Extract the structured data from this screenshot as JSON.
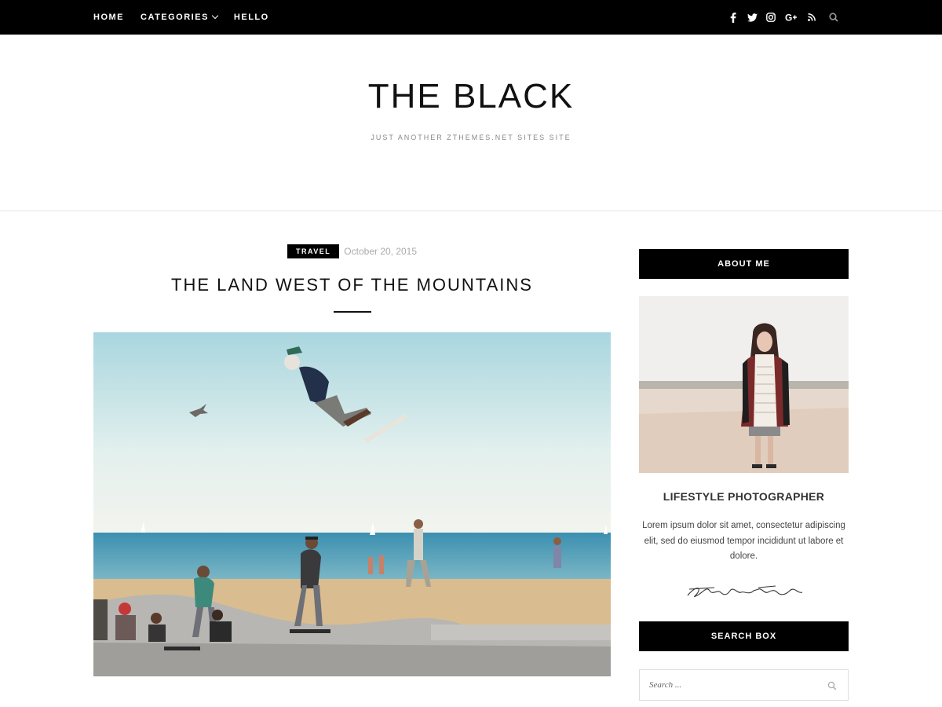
{
  "nav": {
    "items": [
      {
        "label": "HOME"
      },
      {
        "label": "CATEGORIES"
      },
      {
        "label": "HELLO"
      }
    ],
    "social_icons": [
      "facebook-icon",
      "twitter-icon",
      "instagram-icon",
      "google-plus-icon",
      "rss-icon",
      "search-icon"
    ]
  },
  "header": {
    "title": "THE BLACK",
    "tagline": "JUST ANOTHER ZTHEMES.NET SITES SITE"
  },
  "post": {
    "category": "TRAVEL",
    "date": "October 20, 2015",
    "title": "THE LAND WEST OF THE MOUNTAINS",
    "image_alt": "skateboarder-photo"
  },
  "sidebar": {
    "about": {
      "heading_bar": "ABOUT ME",
      "subtitle": "LIFESTYLE PHOTOGRAPHER",
      "text": "Lorem ipsum dolor sit amet, consectetur adipiscing elit, sed do eiusmod tempor incididunt ut labore et dolore.",
      "signature": "ZThemes Team"
    },
    "search": {
      "heading_bar": "SEARCH BOX",
      "placeholder": "Search ..."
    }
  },
  "colors": {
    "bar": "#000000",
    "text": "#111111",
    "muted": "#aaaaaa"
  }
}
